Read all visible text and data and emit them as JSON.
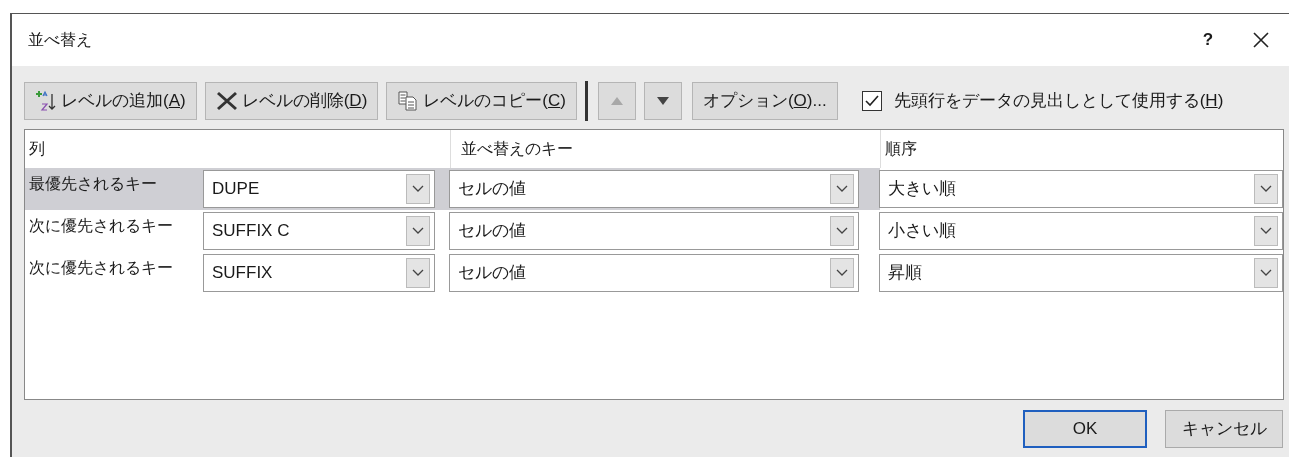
{
  "window": {
    "title": "並べ替え",
    "help": "?"
  },
  "toolbar": {
    "buttons": [
      {
        "kind": "add",
        "before": "レベルの追加(",
        "access_key": "A",
        "after": ")",
        "disabled": false
      },
      {
        "kind": "delete",
        "before": "レベルの削除(",
        "access_key": "D",
        "after": ")",
        "disabled": false
      },
      {
        "kind": "copy",
        "before": "レベルのコピー(",
        "access_key": "C",
        "after": ")",
        "disabled": false
      },
      {
        "kind": "up",
        "disabled": true
      },
      {
        "kind": "down",
        "disabled": false
      },
      {
        "kind": "text",
        "before": "オプション(",
        "access_key": "O",
        "after": ")...",
        "disabled": false
      }
    ],
    "header_checkbox": {
      "before": "先頭行をデータの見出しとして使用する(",
      "access_key": "H",
      "after": ")",
      "checked": true
    }
  },
  "table": {
    "columns": [
      "列",
      "並べ替えのキー",
      "順序"
    ],
    "rows": [
      {
        "label": "最優先されるキー",
        "column": "DUPE",
        "sort_on": "セルの値",
        "order": "大きい順",
        "selected": true
      },
      {
        "label": "次に優先されるキー",
        "column": "SUFFIX C",
        "sort_on": "セルの値",
        "order": "小さい順",
        "selected": false
      },
      {
        "label": "次に優先されるキー",
        "column": "SUFFIX",
        "sort_on": "セルの値",
        "order": "昇順",
        "selected": false
      }
    ]
  },
  "buttons": [
    {
      "label": "OK",
      "default": true
    },
    {
      "label": "キャンセル",
      "default": false
    }
  ]
}
